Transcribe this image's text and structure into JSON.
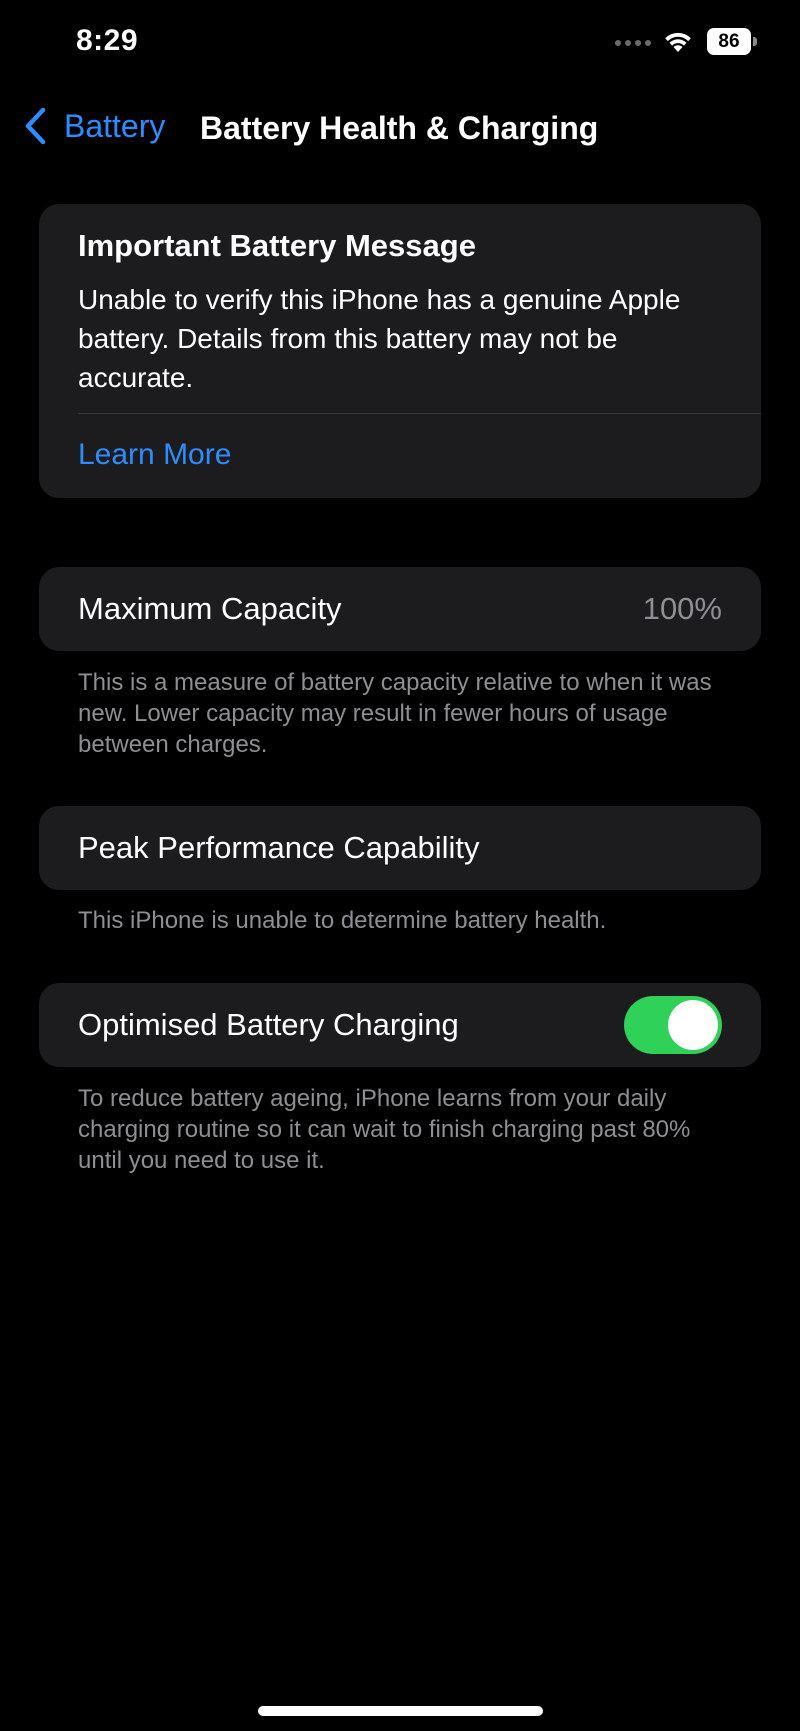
{
  "status_bar": {
    "time": "8:29",
    "battery_level": "86",
    "icons": [
      "signal-dots-icon",
      "wifi-icon",
      "battery-icon"
    ]
  },
  "nav": {
    "back_label": "Battery",
    "title": "Battery Health & Charging",
    "back_icon": "chevron-left-icon"
  },
  "message": {
    "title": "Important Battery Message",
    "body": "Unable to verify this iPhone has a genuine Apple battery. Details from this battery may not be accurate.",
    "link": "Learn More"
  },
  "capacity": {
    "label": "Maximum Capacity",
    "value": "100%",
    "footnote": "This is a measure of battery capacity relative to when it was new. Lower capacity may result in fewer hours of usage between charges."
  },
  "peak": {
    "label": "Peak Performance Capability",
    "footnote": "This iPhone is unable to determine battery health."
  },
  "charging": {
    "label": "Optimised Battery Charging",
    "enabled": true,
    "footnote": "To reduce battery ageing, iPhone learns from your daily charging routine so it can wait to finish charging past 80% until you need to use it."
  },
  "colors": {
    "background": "#000000",
    "card": "#1c1c1e",
    "accent_blue": "#2d8cff",
    "toggle_green": "#30d158",
    "secondary_text": "#8e8e93"
  }
}
